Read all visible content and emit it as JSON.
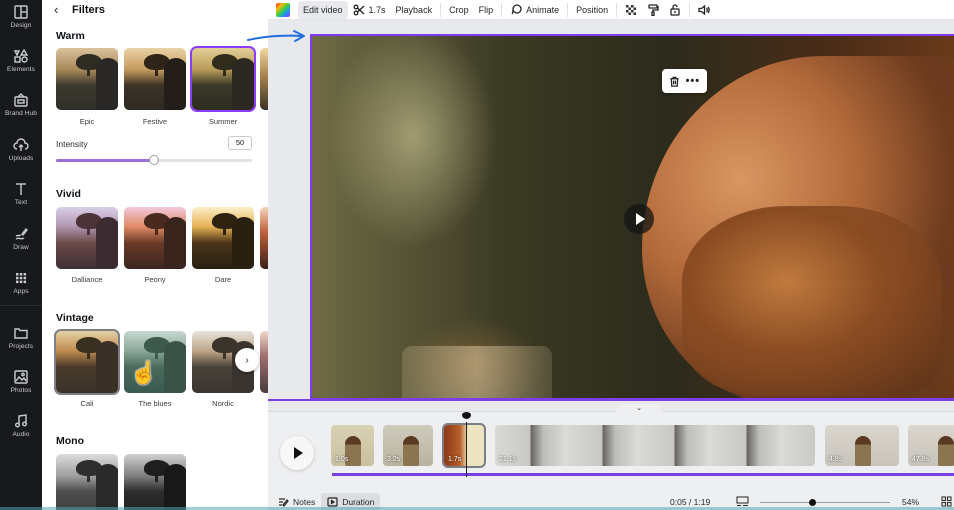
{
  "rail": {
    "items": [
      {
        "label": "Design",
        "icon": "design-icon"
      },
      {
        "label": "Elements",
        "icon": "elements-icon"
      },
      {
        "label": "Brand Hub",
        "icon": "brand-hub-icon"
      },
      {
        "label": "Uploads",
        "icon": "upload-cloud-icon"
      },
      {
        "label": "Text",
        "icon": "text-icon"
      },
      {
        "label": "Draw",
        "icon": "draw-icon"
      },
      {
        "label": "Apps",
        "icon": "apps-grid-icon"
      },
      {
        "label": "Projects",
        "icon": "folder-icon"
      },
      {
        "label": "Photos",
        "icon": "photos-icon"
      },
      {
        "label": "Audio",
        "icon": "music-note-icon"
      }
    ]
  },
  "panel": {
    "back_icon": "chevron-left-icon",
    "title": "Filters",
    "sections": [
      {
        "title": "Warm",
        "filters": [
          {
            "label": "Epic",
            "selected": false
          },
          {
            "label": "Festive",
            "selected": false
          },
          {
            "label": "Summer",
            "selected": true
          }
        ]
      },
      {
        "title": "Vivid",
        "filters": [
          {
            "label": "Dalliance",
            "selected": false
          },
          {
            "label": "Peony",
            "selected": false
          },
          {
            "label": "Dare",
            "selected": false
          }
        ]
      },
      {
        "title": "Vintage",
        "filters": [
          {
            "label": "Cali",
            "selected": false,
            "hovered": true
          },
          {
            "label": "The blues",
            "selected": false
          },
          {
            "label": "Nordic",
            "selected": false
          }
        ]
      },
      {
        "title": "Mono",
        "filters": []
      }
    ],
    "intensity": {
      "label": "Intensity",
      "value": "50",
      "fraction": 0.5
    },
    "next_icon": "chevron-right-icon"
  },
  "toolbar": {
    "color_icon": "color-picker-icon",
    "edit_video": "Edit video",
    "split_icon": "scissors-icon",
    "split_duration": "1.7s",
    "playback": "Playback",
    "crop": "Crop",
    "flip": "Flip",
    "animate_icon": "animate-icon",
    "animate": "Animate",
    "position": "Position",
    "transparency_icon": "transparency-icon",
    "paint_icon": "paint-roller-icon",
    "lock_icon": "lock-icon",
    "volume_icon": "volume-icon"
  },
  "canvas": {
    "delete_icon": "trash-icon",
    "more_icon": "more-horizontal-icon",
    "play_icon": "play-icon"
  },
  "timeline": {
    "collapse_icon": "chevron-down-icon",
    "play_icon": "play-icon",
    "clips": [
      {
        "label": "1.0s"
      },
      {
        "label": "3.2s"
      },
      {
        "label": "1.7s",
        "selected": true
      },
      {
        "label": "21.1s"
      },
      {
        "label": "4.8s"
      },
      {
        "label": "47.8s"
      }
    ]
  },
  "bottombar": {
    "notes": "Notes",
    "notes_icon": "notes-icon",
    "duration": "Duration",
    "duration_icon": "duration-icon",
    "time": "0:05 / 1:19",
    "pages_icon": "pages-view-icon",
    "zoom_fraction": 0.4,
    "zoom_pct": "54%",
    "grid_icon": "grid-view-icon"
  },
  "colors": {
    "accent": "#8b3dff",
    "selection_border": "#7d3cf5",
    "rail_bg": "#18191b",
    "audio_track": "#7b3fe4"
  }
}
